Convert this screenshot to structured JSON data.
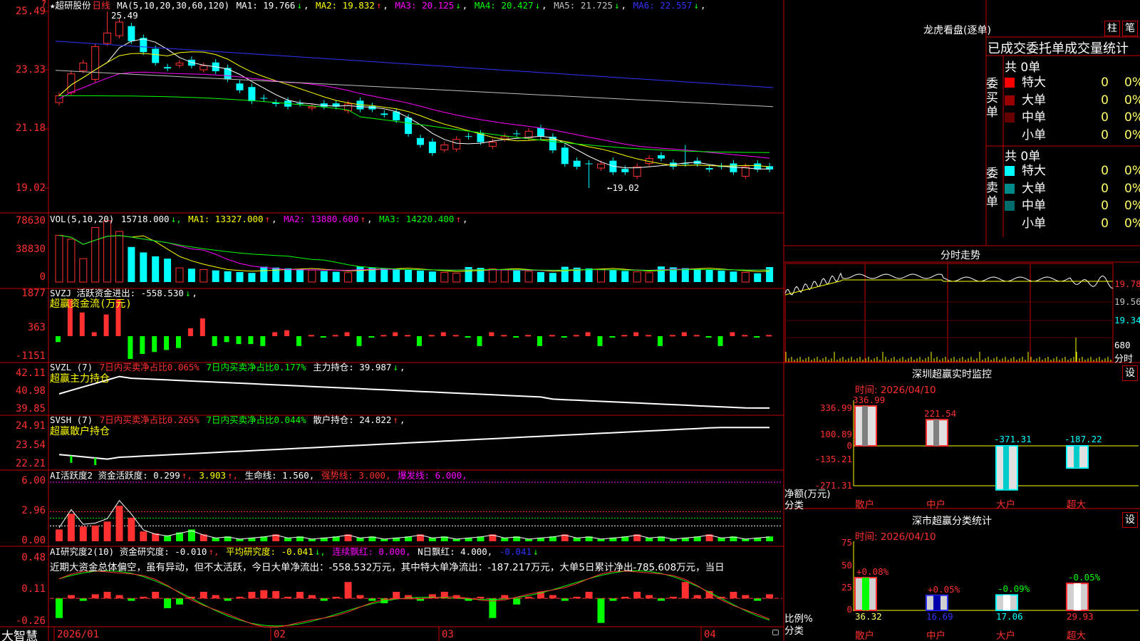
{
  "stock": {
    "name": "★超研股份",
    "period": "日线",
    "ma_header": "MA(5,10,20,30,60,120)",
    "ma_values": [
      {
        "label": "MA1: 19.766",
        "arrow": "↓",
        "color": "#ffffff"
      },
      {
        "label": "MA2: 19.832",
        "arrow": "↑",
        "color": "#ffff00"
      },
      {
        "label": "MA3: 20.125",
        "arrow": "↓",
        "color": "#ff00ff"
      },
      {
        "label": "MA4: 20.427",
        "arrow": "↓",
        "color": "#00ff00"
      },
      {
        "label": "MA5: 21.725",
        "arrow": "↓",
        "color": "#c0c0c0"
      },
      {
        "label": "MA6: 22.557",
        "arrow": "↓",
        "color": "#3333ff"
      }
    ],
    "price_axis": [
      "25.49",
      "23.33",
      "21.18",
      "19.02"
    ],
    "high_label": "25.49",
    "low_label": "←19.02",
    "corner_mark": "?"
  },
  "vol": {
    "header": "VOL(5,10,20)",
    "value": "15718.000",
    "ma": [
      {
        "label": "MA1: 13327.000",
        "arrow": "↑",
        "color": "#ffff00"
      },
      {
        "label": "MA2: 13880.600",
        "arrow": "↑",
        "color": "#ff00ff"
      },
      {
        "label": "MA3: 14220.400",
        "arrow": "↑",
        "color": "#00ff00"
      }
    ],
    "axis": [
      "78630",
      "38830",
      "0"
    ]
  },
  "svzj": {
    "header": "SVZJ  活跃资金进出: -558.530",
    "arrow": "↓",
    "subtitle": "超赢资金流(万元)",
    "axis": [
      "1877",
      "363",
      "-1151"
    ]
  },
  "svzl": {
    "header_prefix": "SVZL (7)",
    "a": "7日内买卖净占比0.065%",
    "b": "7日内买卖净占比0.177%",
    "c": "主力持仓: 39.987",
    "arrow": "↓",
    "subtitle": "超赢主力持仓",
    "axis": [
      "42.11",
      "40.98",
      "39.85"
    ]
  },
  "svsh": {
    "header_prefix": "SVSH (7)",
    "a": "7日内买卖净占比0.265%",
    "b": "7日内买卖净占比0.044%",
    "c": "散户持仓: 24.822",
    "arrow": "↑",
    "subtitle": "超赢散户持仓",
    "axis": [
      "24.91",
      "23.54",
      "22.21"
    ]
  },
  "ai_active": {
    "header": "AI活跃度2 资金活跃度: 0.299",
    "v2": "3.903",
    "life": "生命线: 1.560,",
    "strong": "强势线: 3.000,",
    "burst": "爆发线: 6.000,",
    "axis": [
      "6.00",
      "2.96",
      "0.00"
    ]
  },
  "ai_research": {
    "header": "AI研究度2(10) 资金研究度: -0.010",
    "avg": "平均研究度: -0.041",
    "red": "连续飘红: 0.000,",
    "n": "N日飘红: 4.000,",
    "last": "-0.041",
    "comment": "近期大资金总体偏空，虽有异动，但不太活跃，今日大单净流出：-558.532万元，其中特大单净流出：-187.217万元，大单5日累计净出-785.608万元，当日",
    "axis": [
      "0.48",
      "0.11",
      "-0.26"
    ]
  },
  "date_axis": [
    "2026/01",
    "02",
    "03",
    "04"
  ],
  "brand": "大智慧",
  "lhb": {
    "title": "龙虎看盘(逐单)",
    "btn1": "柱",
    "btn2": "笔",
    "subtitle": "已成交委托单成交量统计",
    "buy_label": "委买单",
    "sell_label": "委卖单",
    "buy_total": "共 0单",
    "sell_total": "共 0单",
    "buy": [
      {
        "name": "特大",
        "count": "0",
        "pct": "0%",
        "color": "#ff0000"
      },
      {
        "name": "大单",
        "count": "0",
        "pct": "0%",
        "color": "#990000"
      },
      {
        "name": "中单",
        "count": "0",
        "pct": "0%",
        "color": "#660000"
      },
      {
        "name": "小单",
        "count": "0",
        "pct": "0%",
        "color": "#000000"
      }
    ],
    "sell": [
      {
        "name": "特大",
        "count": "0",
        "pct": "0%",
        "color": "#00ffff"
      },
      {
        "name": "大单",
        "count": "0",
        "pct": "0%",
        "color": "#008b8b"
      },
      {
        "name": "中单",
        "count": "0",
        "pct": "0%",
        "color": "#006b6b"
      },
      {
        "name": "小单",
        "count": "0",
        "pct": "0%",
        "color": "#000000"
      }
    ]
  },
  "intraday": {
    "title": "分时走势",
    "axis": [
      "19.78",
      "19.56",
      "19.34"
    ],
    "vol_label": "680",
    "footer": "分时"
  },
  "sz_monitor": {
    "title": "深圳超赢实时监控",
    "btn": "设",
    "time": "时间: 2026/04/10",
    "axis": [
      "336.99",
      "100.89",
      "0",
      "-135.21",
      "-271.31"
    ],
    "ylabel1": "净额(万元)",
    "ylabel2": "分类",
    "bars": [
      {
        "name": "散户",
        "value": "336.99"
      },
      {
        "name": "中户",
        "value": "221.54"
      },
      {
        "name": "大户",
        "value": "-371.31"
      },
      {
        "name": "超大",
        "value": "-187.22"
      }
    ]
  },
  "sz_class": {
    "title": "深市超赢分类统计",
    "btn": "设",
    "time": "时间: 2026/04/10",
    "axis": [
      "75",
      "50",
      "25",
      "0"
    ],
    "ylabel1": "比例%",
    "ylabel2": "分类",
    "bars": [
      {
        "name": "散户",
        "pct": "36.32",
        "chg": "+0.08%"
      },
      {
        "name": "中户",
        "pct": "16.69",
        "chg": "+0.05%"
      },
      {
        "name": "大户",
        "pct": "17.06",
        "chg": "-0.09%"
      },
      {
        "name": "超大",
        "pct": "29.93",
        "chg": "-0.05%"
      }
    ]
  }
}
